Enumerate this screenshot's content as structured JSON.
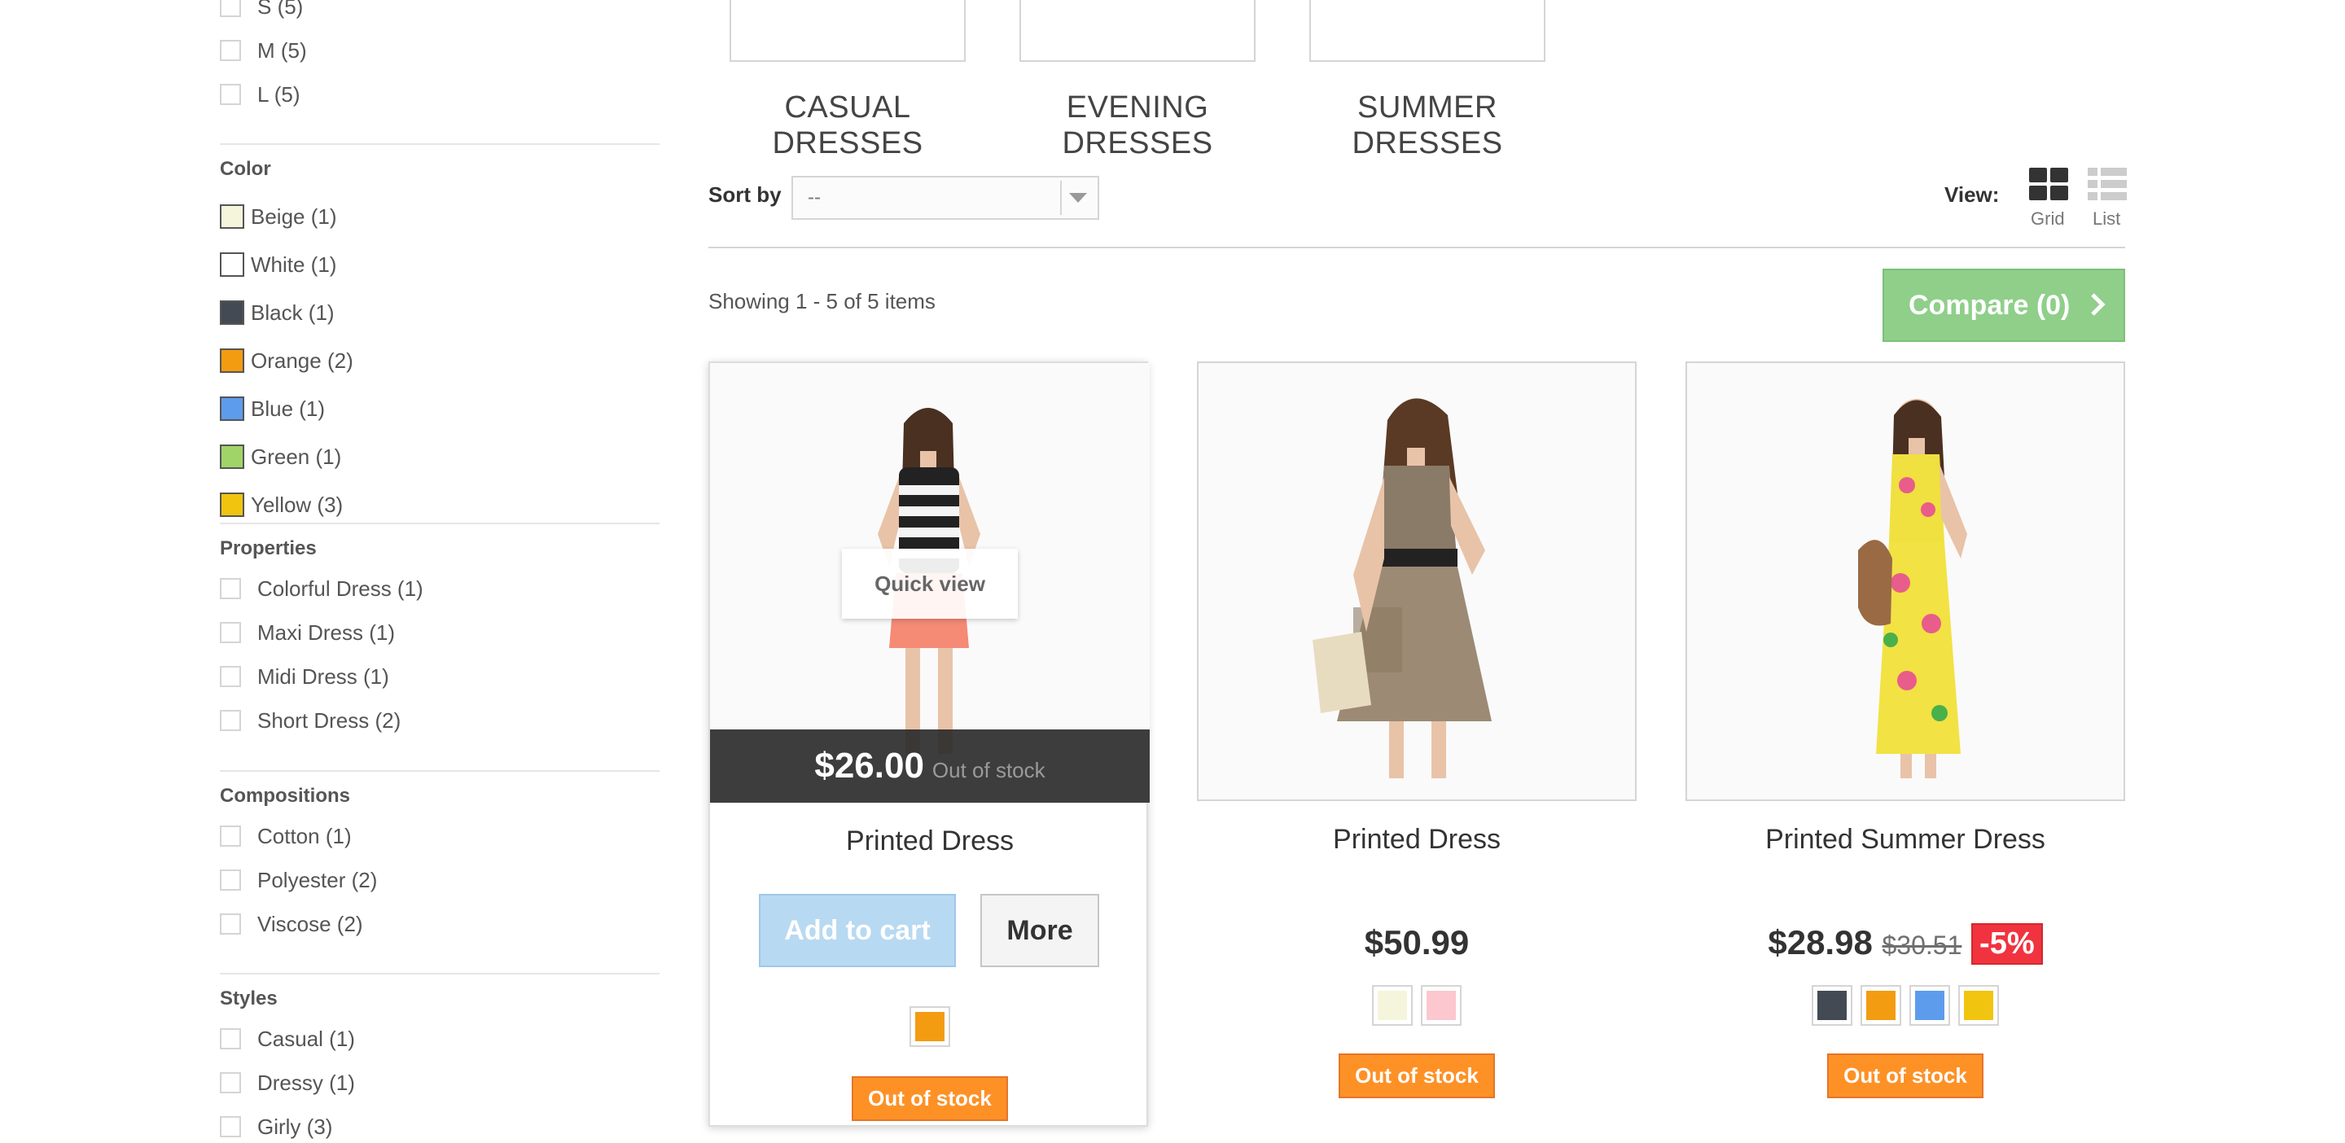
{
  "sidebar": {
    "sizes": [
      "S (5)",
      "M (5)",
      "L (5)"
    ],
    "color_title": "Color",
    "colors": [
      {
        "label": "Beige (1)",
        "swatch": "#f5f5dc"
      },
      {
        "label": "White (1)",
        "swatch": "#ffffff"
      },
      {
        "label": "Black (1)",
        "swatch": "#434a54"
      },
      {
        "label": "Orange (2)",
        "swatch": "#f39c11"
      },
      {
        "label": "Blue (1)",
        "swatch": "#5d9cec"
      },
      {
        "label": "Green (1)",
        "swatch": "#a0d468"
      },
      {
        "label": "Yellow (3)",
        "swatch": "#f1c40f"
      }
    ],
    "properties_title": "Properties",
    "properties": [
      "Colorful Dress (1)",
      "Maxi Dress (1)",
      "Midi Dress (1)",
      "Short Dress (2)"
    ],
    "compositions_title": "Compositions",
    "compositions": [
      "Cotton (1)",
      "Polyester (2)",
      "Viscose (2)"
    ],
    "styles_title": "Styles",
    "styles": [
      "Casual (1)",
      "Dressy (1)",
      "Girly (3)"
    ]
  },
  "subcategories": [
    {
      "line1": "CASUAL",
      "line2": "DRESSES"
    },
    {
      "line1": "EVENING",
      "line2": "DRESSES"
    },
    {
      "line1": "SUMMER",
      "line2": "DRESSES"
    }
  ],
  "toolbar": {
    "sort_label": "Sort by",
    "sort_value": "--",
    "view_label": "View:",
    "view_grid": "Grid",
    "view_list": "List",
    "showing": "Showing 1 - 5 of 5 items",
    "compare": "Compare (0)"
  },
  "products": [
    {
      "name": "Printed Dress",
      "price": "$26.00",
      "stock_overlay": "Out of stock",
      "quick_view": "Quick view",
      "add_to_cart": "Add to cart",
      "more": "More",
      "colors": [
        "#f39c11"
      ],
      "stock": "Out of stock"
    },
    {
      "name": "Printed Dress",
      "price": "$50.99",
      "colors": [
        "#f5f5dc",
        "#fcc7cf"
      ],
      "stock": "Out of stock"
    },
    {
      "name": "Printed Summer Dress",
      "price": "$28.98",
      "old_price": "$30.51",
      "discount": "-5%",
      "colors": [
        "#434a54",
        "#f39c11",
        "#5d9cec",
        "#f1c40f"
      ],
      "stock": "Out of stock"
    }
  ]
}
